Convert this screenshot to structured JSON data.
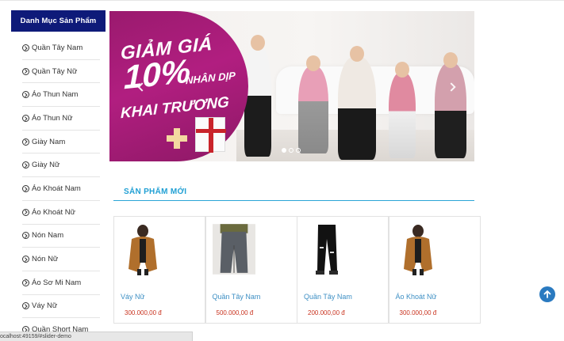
{
  "sidebar": {
    "heading": "Danh Mục Sản Phẩm",
    "items": [
      {
        "label": "Quần Tây Nam"
      },
      {
        "label": "Quần Tây Nữ"
      },
      {
        "label": "Áo Thun Nam"
      },
      {
        "label": "Áo Thun Nữ"
      },
      {
        "label": "Giày Nam"
      },
      {
        "label": "Giày Nữ"
      },
      {
        "label": "Áo Khoát Nam"
      },
      {
        "label": "Áo Khoát Nữ"
      },
      {
        "label": "Nón Nam"
      },
      {
        "label": "Nón Nữ"
      },
      {
        "label": "Áo Sơ Mi Nam"
      },
      {
        "label": "Váy Nữ"
      },
      {
        "label": "Quần Short Nam"
      }
    ],
    "item_icon": "chevron-circle-right-icon"
  },
  "banner": {
    "line1": "GIẢM GIÁ",
    "line2": "10%",
    "line3a": "NHÂN DỊP",
    "line4": "KHAI TRƯƠNG",
    "slide_count": 3,
    "active_slide": 1,
    "colors": {
      "purple": "#a81c78"
    }
  },
  "section": {
    "title": "SẢN PHẨM MỚI"
  },
  "products": [
    {
      "name": "Váy Nữ",
      "price": "300.000,00 đ",
      "image": "brown-cardigan"
    },
    {
      "name": "Quần Tây Nam",
      "price": "500.000,00 đ",
      "image": "gray-trousers"
    },
    {
      "name": "Quần Tây Nam",
      "price": "200.000,00 đ",
      "image": "black-ripped-jeans"
    },
    {
      "name": "Áo Khoát Nữ",
      "price": "300.000,00 đ",
      "image": "brown-cardigan"
    }
  ],
  "status_bar": {
    "url": "ocalhost:49159/#slider-demo"
  },
  "colors": {
    "sidebar_head": "#0e1a79",
    "accent": "#21a0d4",
    "price": "#c9331f",
    "link": "#3d8fc4"
  }
}
